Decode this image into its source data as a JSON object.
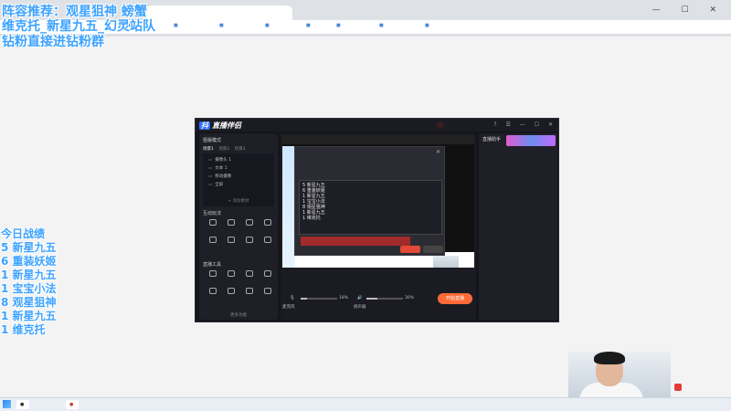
{
  "browser": {
    "tab_label": "",
    "window_controls": "— ☐ ✕",
    "bookmarks": [
      "",
      "",
      "",
      "",
      "",
      "",
      "",
      "",
      "",
      ""
    ]
  },
  "overlay": {
    "line1": "阵容推荐：观星狙神 螃蟹",
    "line2": "维克托_新星九五_幻灵站队",
    "line3": "钻粉直接进钻粉群",
    "score_title": "今日战绩",
    "scores": [
      "5 新星九五",
      "6 重装妖姬",
      "1 新星九五",
      "1 宝宝小法",
      "8 观星狙神",
      "1 新星九五",
      "1 维克托"
    ]
  },
  "app": {
    "logo_mark": "抖",
    "logo_text": "直播伴侣",
    "version": "",
    "record_pill": "",
    "title_controls": "? ☰ — ☐ ✕",
    "left": {
      "mode": "竖版模式",
      "mode_right": "",
      "scene_tabs": [
        "场景1",
        "场景2",
        "场景3"
      ],
      "scenes": [
        "摄像头 1",
        "文本 1",
        "移动摄像",
        "全屏"
      ],
      "add_source": "+ 添加素材",
      "interactive_title": "互动玩法",
      "interactive_tools": [
        "",
        "",
        "",
        "",
        "",
        "",
        "",
        ""
      ],
      "tools_title": "直播工具",
      "live_tools": [
        "",
        "",
        "",
        "",
        "",
        "",
        "",
        ""
      ],
      "more": "更多功能"
    },
    "center": {
      "preview_label": "",
      "dialog": {
        "title": "",
        "close": "✕",
        "radio": "",
        "toolbar": "",
        "lines": [
          "5 新星九五",
          "6 重装妖姬",
          "1 新星九五",
          "1 宝宝小法",
          "8 观星狙神",
          "1 新星九五",
          "1 维克托"
        ],
        "warning": "",
        "confirm": "",
        "cancel": ""
      },
      "audio": {
        "mic_label": "麦克风",
        "mic_volume": "18%",
        "speaker_label": "扬声器",
        "speaker_volume": "30%",
        "start_button": "开始直播",
        "status": ""
      }
    },
    "right": {
      "title": "直播助手",
      "tabs": [
        "",
        "",
        ""
      ],
      "messages": [
        "",
        "",
        "",
        "",
        "",
        "",
        "",
        ""
      ],
      "badge": ""
    }
  },
  "taskbar": {
    "apps": [
      "",
      ""
    ],
    "clock_time": "",
    "clock_date": "",
    "tray": ""
  },
  "colors": {
    "overlay_text": "#3da3ff",
    "start_button": "#ff6a38",
    "app_bg": "#15161c"
  },
  "levels": {
    "mic_volume": 0.18,
    "speaker_volume": 0.3
  }
}
